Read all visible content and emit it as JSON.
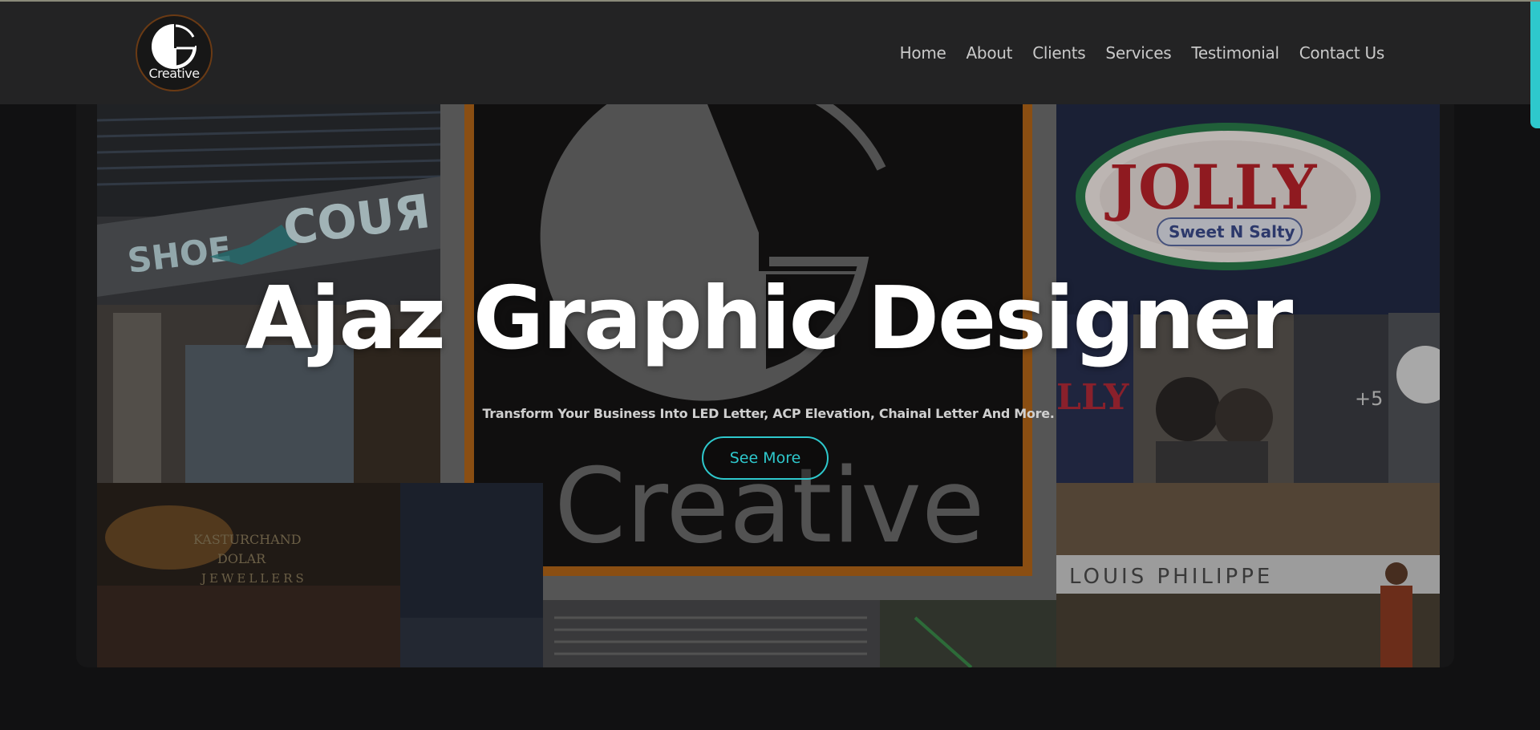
{
  "brand": {
    "logo_text": "Creative"
  },
  "nav": {
    "items": [
      "Home",
      "About",
      "Clients",
      "Services",
      "Testimonial",
      "Contact Us"
    ]
  },
  "hero": {
    "title": "Ajaz Graphic Designer",
    "subtitle": "Transform Your Business Into LED Letter, ACP Elevation, Chainal Letter And More.",
    "button_label": "See More"
  },
  "collage": {
    "shoe_sign": "SHOE",
    "shoe_sign_2": "COUЯ",
    "center_logo_text": "Creative",
    "jolly_sign": "JOLLY",
    "jolly_tagline": "Sweet N Salty",
    "jolly_small": "LLY",
    "more_count": "+5",
    "louis_sign": "LOUIS PHILIPPE",
    "jewellers_sign_1": "KASTURCHAND",
    "jewellers_sign_2": "DOLAR",
    "jewellers_sign_3": "JEWELLERS"
  },
  "colors": {
    "accent": "#2ec8cc",
    "navbar_bg": "#232324",
    "page_bg": "#111112"
  }
}
